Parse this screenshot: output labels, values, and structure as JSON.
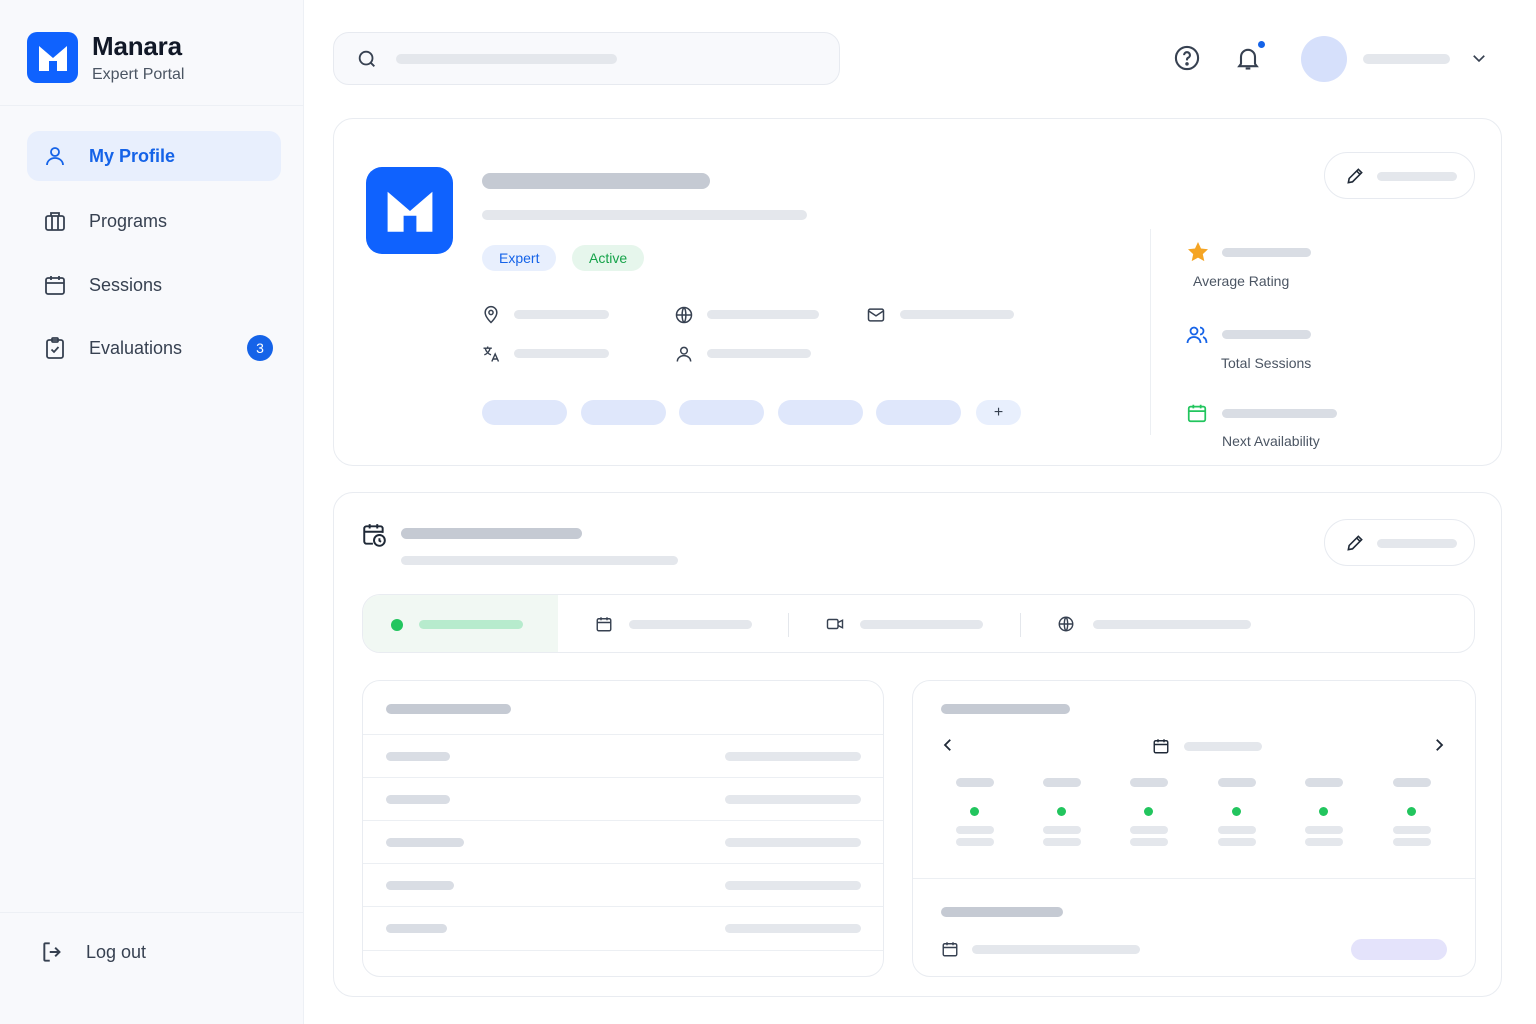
{
  "brand": {
    "name": "Manara",
    "subtitle": "Expert Portal"
  },
  "sidebar": {
    "items": [
      {
        "label": "My Profile",
        "icon": "user-icon",
        "active": true
      },
      {
        "label": "Programs",
        "icon": "briefcase-icon"
      },
      {
        "label": "Sessions",
        "icon": "calendar-icon"
      },
      {
        "label": "Evaluations",
        "icon": "clipboard-check-icon",
        "badge": "3"
      }
    ],
    "logout_label": "Log out"
  },
  "profile": {
    "badges": {
      "expert": "Expert",
      "active": "Active"
    },
    "add_label": "+",
    "stats": {
      "rating_label": "Average Rating",
      "sessions_label": "Total Sessions",
      "availability_label": "Next Availability"
    }
  },
  "colors": {
    "primary": "#1563e8",
    "brand": "#0f62fe",
    "success": "#22c55e",
    "star": "#f5a524"
  }
}
